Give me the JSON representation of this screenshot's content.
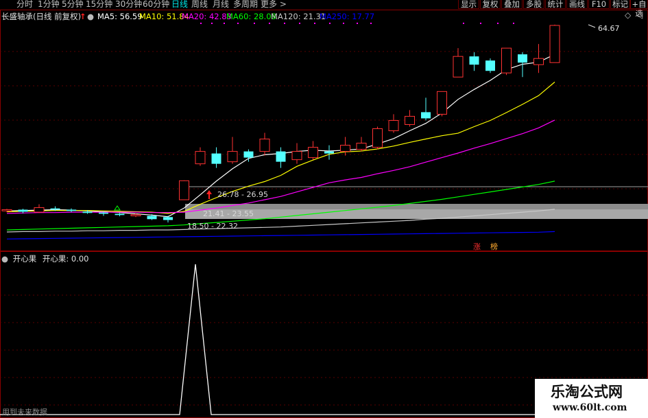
{
  "periods": [
    {
      "label": "分时",
      "active": false
    },
    {
      "label": "1分钟",
      "active": false
    },
    {
      "label": "5分钟",
      "active": false
    },
    {
      "label": "15分钟",
      "active": false
    },
    {
      "label": "30分钟",
      "active": false
    },
    {
      "label": "60分钟",
      "active": false
    },
    {
      "label": "日线",
      "active": true
    },
    {
      "label": "周线",
      "active": false
    },
    {
      "label": "月线",
      "active": false
    },
    {
      "label": "多周期",
      "active": false
    },
    {
      "label": "更多 >",
      "active": false
    }
  ],
  "right_buttons": [
    "显示",
    "复权",
    "叠加",
    "多股",
    "统计",
    "画线",
    "F10",
    "标记",
    "+自选"
  ],
  "stock_title": "长盛轴承(日线 前复权)",
  "ma_legend": [
    {
      "label": "MA5: 56.59",
      "color": "#ffffff"
    },
    {
      "label": "MA10: 51.84",
      "color": "#ffff00"
    },
    {
      "label": "MA20: 42.83",
      "color": "#ff00ff"
    },
    {
      "label": "MA60: 28.08",
      "color": "#00ff00"
    },
    {
      "label": "MA120: 21.31",
      "color": "#c8c8c8"
    },
    {
      "label": "MA250: 17.77",
      "color": "#0000ff"
    }
  ],
  "annotations": {
    "high_price": "64.67",
    "range_upper": "26.78 - 26.95",
    "range_lower": "21.41 - 23.55",
    "range_bottom": "18.50 - 22.32",
    "tag_zhang": "涨",
    "tag_bang": "榜"
  },
  "indicator": {
    "title": "开心果",
    "value_label": "开心果: 0.00"
  },
  "footer_note": "用到未来数据",
  "watermark": {
    "line1": "乐淘公式网",
    "line2": "www.60lt.com"
  },
  "colors": {
    "up": "#ff3232",
    "down": "#54ffff",
    "border": "#8a0000"
  },
  "candles": [
    {
      "o": 19.6,
      "c": 19.9,
      "h": 20.1,
      "l": 19.3
    },
    {
      "o": 19.9,
      "c": 19.4,
      "h": 20.1,
      "l": 19.0
    },
    {
      "o": 19.3,
      "c": 20.4,
      "h": 21.2,
      "l": 19.1
    },
    {
      "o": 20.2,
      "c": 19.9,
      "h": 20.7,
      "l": 19.6
    },
    {
      "o": 19.9,
      "c": 19.6,
      "h": 20.2,
      "l": 19.3
    },
    {
      "o": 19.4,
      "c": 19.1,
      "h": 19.8,
      "l": 18.9
    },
    {
      "o": 19.2,
      "c": 18.9,
      "h": 19.5,
      "l": 18.4
    },
    {
      "o": 18.9,
      "c": 18.6,
      "h": 19.1,
      "l": 18.3
    },
    {
      "o": 18.4,
      "c": 18.7,
      "h": 19.0,
      "l": 18.1
    },
    {
      "o": 18.4,
      "c": 17.6,
      "h": 18.8,
      "l": 17.4
    },
    {
      "o": 18.1,
      "c": 17.4,
      "h": 18.4,
      "l": 16.8
    },
    {
      "o": 22.3,
      "c": 26.9,
      "h": 27.0,
      "l": 22.3
    },
    {
      "o": 31.0,
      "c": 34.0,
      "h": 35.0,
      "l": 30.5
    },
    {
      "o": 33.5,
      "c": 31.0,
      "h": 35.0,
      "l": 30.0
    },
    {
      "o": 31.5,
      "c": 34.0,
      "h": 37.5,
      "l": 31.0
    },
    {
      "o": 34.0,
      "c": 32.5,
      "h": 34.5,
      "l": 31.5
    },
    {
      "o": 34.0,
      "c": 37.0,
      "h": 38.5,
      "l": 33.0
    },
    {
      "o": 34.0,
      "c": 31.5,
      "h": 35.0,
      "l": 30.0
    },
    {
      "o": 32.0,
      "c": 34.0,
      "h": 36.0,
      "l": 31.0
    },
    {
      "o": 32.5,
      "c": 35.0,
      "h": 36.5,
      "l": 32.0
    },
    {
      "o": 34.0,
      "c": 33.5,
      "h": 35.5,
      "l": 32.0
    },
    {
      "o": 34.0,
      "c": 35.5,
      "h": 37.5,
      "l": 33.0
    },
    {
      "o": 34.5,
      "c": 36.0,
      "h": 37.5,
      "l": 34.0
    },
    {
      "o": 35.0,
      "c": 39.5,
      "h": 40.0,
      "l": 34.5
    },
    {
      "o": 39.0,
      "c": 41.5,
      "h": 43.0,
      "l": 38.5
    },
    {
      "o": 40.5,
      "c": 42.5,
      "h": 44.0,
      "l": 40.0
    },
    {
      "o": 43.5,
      "c": 42.0,
      "h": 47.0,
      "l": 41.5
    },
    {
      "o": 43.0,
      "c": 48.5,
      "h": 48.5,
      "l": 42.5
    },
    {
      "o": 52.0,
      "c": 57.0,
      "h": 59.0,
      "l": 52.0
    },
    {
      "o": 57.0,
      "c": 55.0,
      "h": 58.0,
      "l": 53.5
    },
    {
      "o": 56.0,
      "c": 53.5,
      "h": 56.5,
      "l": 53.0
    },
    {
      "o": 53.0,
      "c": 59.0,
      "h": 59.0,
      "l": 52.5
    },
    {
      "o": 57.5,
      "c": 55.5,
      "h": 58.0,
      "l": 52.0
    },
    {
      "o": 55.0,
      "c": 56.5,
      "h": 60.0,
      "l": 53.0
    },
    {
      "o": 55.5,
      "c": 64.5,
      "h": 64.7,
      "l": 55.5
    }
  ],
  "ma_series": {
    "ma5": [
      19.6,
      19.7,
      19.8,
      19.9,
      19.8,
      19.6,
      19.4,
      19.2,
      18.9,
      18.6,
      18.2,
      20.3,
      23.5,
      26.8,
      29.8,
      32.3,
      33.2,
      33.5,
      34.0,
      34.3,
      34.1,
      34.3,
      34.6,
      35.8,
      37.1,
      39.0,
      40.8,
      43.3,
      46.6,
      49.0,
      51.2,
      53.8,
      55.1,
      55.6,
      57.5
    ],
    "ma10": [
      19.4,
      19.5,
      19.6,
      19.7,
      19.7,
      19.7,
      19.6,
      19.5,
      19.4,
      19.3,
      19.0,
      19.5,
      21.2,
      22.8,
      24.3,
      25.6,
      26.7,
      28.2,
      30.4,
      31.9,
      33.3,
      33.9,
      34.1,
      34.6,
      35.3,
      36.2,
      37.0,
      37.8,
      38.4,
      40.0,
      41.5,
      43.4,
      45.4,
      47.5,
      50.8
    ],
    "ma20": [
      19.0,
      19.1,
      19.2,
      19.2,
      19.3,
      19.3,
      19.3,
      19.3,
      19.3,
      19.2,
      19.2,
      19.3,
      19.8,
      20.3,
      20.9,
      21.5,
      22.3,
      23.1,
      24.2,
      25.3,
      26.4,
      27.1,
      27.7,
      28.6,
      29.4,
      30.3,
      31.4,
      32.5,
      33.6,
      34.8,
      35.9,
      37.1,
      38.3,
      39.7,
      41.6
    ],
    "ma60": [
      15.0,
      15.1,
      15.2,
      15.3,
      15.4,
      15.5,
      15.6,
      15.7,
      15.8,
      15.9,
      16.0,
      16.2,
      16.5,
      16.8,
      17.1,
      17.4,
      17.7,
      18.1,
      18.5,
      18.9,
      19.3,
      19.7,
      20.1,
      20.5,
      20.9,
      21.4,
      21.9,
      22.4,
      23.0,
      23.6,
      24.2,
      24.8,
      25.4,
      26.0,
      26.8
    ],
    "ma120": [
      14.5,
      14.6,
      14.6,
      14.7,
      14.7,
      14.8,
      14.8,
      14.9,
      14.9,
      15.0,
      15.0,
      15.1,
      15.2,
      15.3,
      15.4,
      15.5,
      15.6,
      15.7,
      15.9,
      16.1,
      16.3,
      16.5,
      16.7,
      16.9,
      17.1,
      17.3,
      17.6,
      17.8,
      18.1,
      18.4,
      18.7,
      19.0,
      19.3,
      19.6,
      20.0
    ],
    "ma250": [
      12.8,
      12.85,
      12.9,
      12.95,
      13.0,
      13.05,
      13.1,
      13.15,
      13.2,
      13.25,
      13.3,
      13.35,
      13.4,
      13.45,
      13.5,
      13.55,
      13.6,
      13.65,
      13.7,
      13.75,
      13.8,
      13.85,
      13.9,
      13.95,
      14.0,
      14.05,
      14.1,
      14.15,
      14.2,
      14.25,
      14.3,
      14.35,
      14.4,
      14.45,
      14.6
    ]
  },
  "indicator_values": [
    0,
    0,
    0,
    0,
    0,
    0,
    0,
    0,
    0,
    0,
    0,
    1,
    0,
    0,
    0,
    0,
    0,
    0,
    0,
    0,
    0,
    0,
    0,
    0,
    0,
    0,
    0,
    0,
    0,
    0,
    0,
    0,
    0,
    0,
    0
  ]
}
